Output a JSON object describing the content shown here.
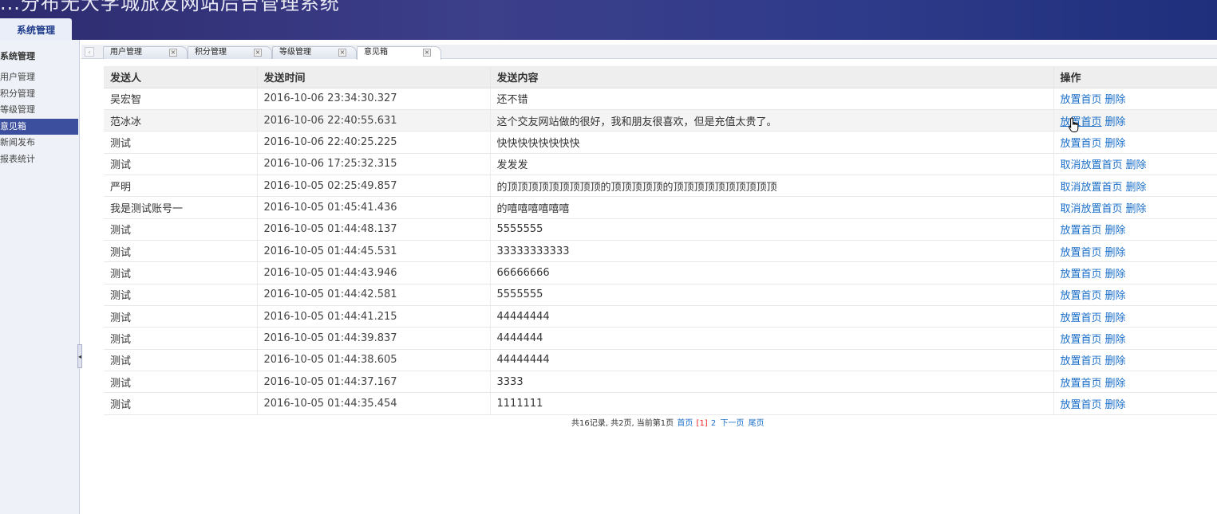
{
  "header": {
    "title": "...分布无大学城旅友网站后台管理系统",
    "menu_tab": "系统管理"
  },
  "sidebar": {
    "group_title": "系统管理",
    "items": [
      {
        "label": "用户管理"
      },
      {
        "label": "积分管理"
      },
      {
        "label": "等级管理"
      },
      {
        "label": "意见箱",
        "active": true
      },
      {
        "label": "新闻发布"
      },
      {
        "label": "报表统计"
      }
    ]
  },
  "tabs": [
    {
      "label": "用户管理",
      "close": "×"
    },
    {
      "label": "积分管理",
      "close": "×"
    },
    {
      "label": "等级管理",
      "close": "×"
    },
    {
      "label": "意见箱",
      "close": "×",
      "active": true
    }
  ],
  "table": {
    "headers": [
      "发送人",
      "发送时间",
      "发送内容",
      "操作"
    ],
    "rows": [
      {
        "sender": "吴宏智",
        "time": "2016-10-06 23:34:30.327",
        "content": "还不错",
        "op1": "放置首页",
        "op2": "删除"
      },
      {
        "sender": "范冰冰",
        "time": "2016-10-06 22:40:55.631",
        "content": "这个交友网站做的很好，我和朋友很喜欢，但是充值太贵了。",
        "op1": "放置首页",
        "op2": "删除"
      },
      {
        "sender": "测试",
        "time": "2016-10-06 22:40:25.225",
        "content": "快快快快快快快快",
        "op1": "放置首页",
        "op2": "删除"
      },
      {
        "sender": "测试",
        "time": "2016-10-06 17:25:32.315",
        "content": "发发发",
        "op1": "取消放置首页",
        "op2": "删除"
      },
      {
        "sender": "严明",
        "time": "2016-10-05 02:25:49.857",
        "content": "的顶顶顶顶顶顶顶顶顶的顶顶顶顶顶的顶顶顶顶顶顶顶顶顶顶",
        "op1": "取消放置首页",
        "op2": "删除"
      },
      {
        "sender": "我是测试账号一",
        "time": "2016-10-05 01:45:41.436",
        "content": "的嘻嘻嘻嘻嘻嘻",
        "op1": "取消放置首页",
        "op2": "删除"
      },
      {
        "sender": "测试",
        "time": "2016-10-05 01:44:48.137",
        "content": "5555555",
        "op1": "放置首页",
        "op2": "删除"
      },
      {
        "sender": "测试",
        "time": "2016-10-05 01:44:45.531",
        "content": "33333333333",
        "op1": "放置首页",
        "op2": "删除"
      },
      {
        "sender": "测试",
        "time": "2016-10-05 01:44:43.946",
        "content": "66666666",
        "op1": "放置首页",
        "op2": "删除"
      },
      {
        "sender": "测试",
        "time": "2016-10-05 01:44:42.581",
        "content": "5555555",
        "op1": "放置首页",
        "op2": "删除"
      },
      {
        "sender": "测试",
        "time": "2016-10-05 01:44:41.215",
        "content": "44444444",
        "op1": "放置首页",
        "op2": "删除"
      },
      {
        "sender": "测试",
        "time": "2016-10-05 01:44:39.837",
        "content": "4444444",
        "op1": "放置首页",
        "op2": "删除"
      },
      {
        "sender": "测试",
        "time": "2016-10-05 01:44:38.605",
        "content": "44444444",
        "op1": "放置首页",
        "op2": "删除"
      },
      {
        "sender": "测试",
        "time": "2016-10-05 01:44:37.167",
        "content": "3333",
        "op1": "放置首页",
        "op2": "删除"
      },
      {
        "sender": "测试",
        "time": "2016-10-05 01:44:35.454",
        "content": "1111111",
        "op1": "放置首页",
        "op2": "删除"
      }
    ]
  },
  "pager": {
    "summary": "共16记录, 共2页, 当前第1页",
    "first": "首页",
    "current": "[1]",
    "page2": "2",
    "next": "下一页",
    "last": "尾页"
  },
  "colors": {
    "link": "#1a6ec8",
    "active_nav": "#3c4e9e",
    "header_bg": "#2d2b6f"
  }
}
